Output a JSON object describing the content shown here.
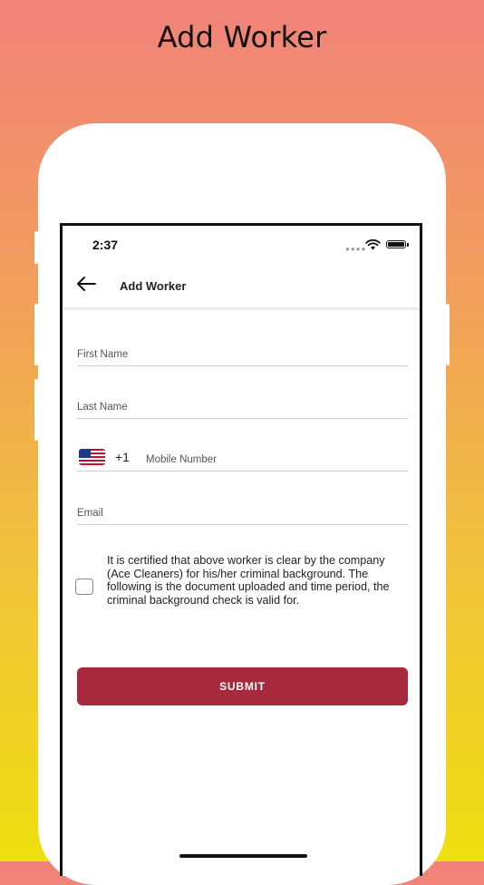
{
  "banner": {
    "title": "Add Worker"
  },
  "status_bar": {
    "time": "2:37"
  },
  "nav": {
    "title": "Add Worker"
  },
  "form": {
    "first_name_placeholder": "First Name",
    "last_name_placeholder": "Last Name",
    "country_code": "+1",
    "mobile_placeholder": "Mobile Number",
    "email_placeholder": "Email"
  },
  "certification": {
    "text": "It is certified that above worker is clear by the company (Ace Cleaners) for his/her criminal background. The following is the document uploaded and time period, the criminal background check is valid for.",
    "checked": false
  },
  "submit_label": "SUBMIT",
  "colors": {
    "submit_button": "#a8283c",
    "background_top": "#f1827a",
    "background_bottom": "#efdf10"
  },
  "icons": [
    "back-arrow-icon",
    "us-flag-icon",
    "wifi-icon",
    "battery-icon",
    "signal-icon"
  ]
}
